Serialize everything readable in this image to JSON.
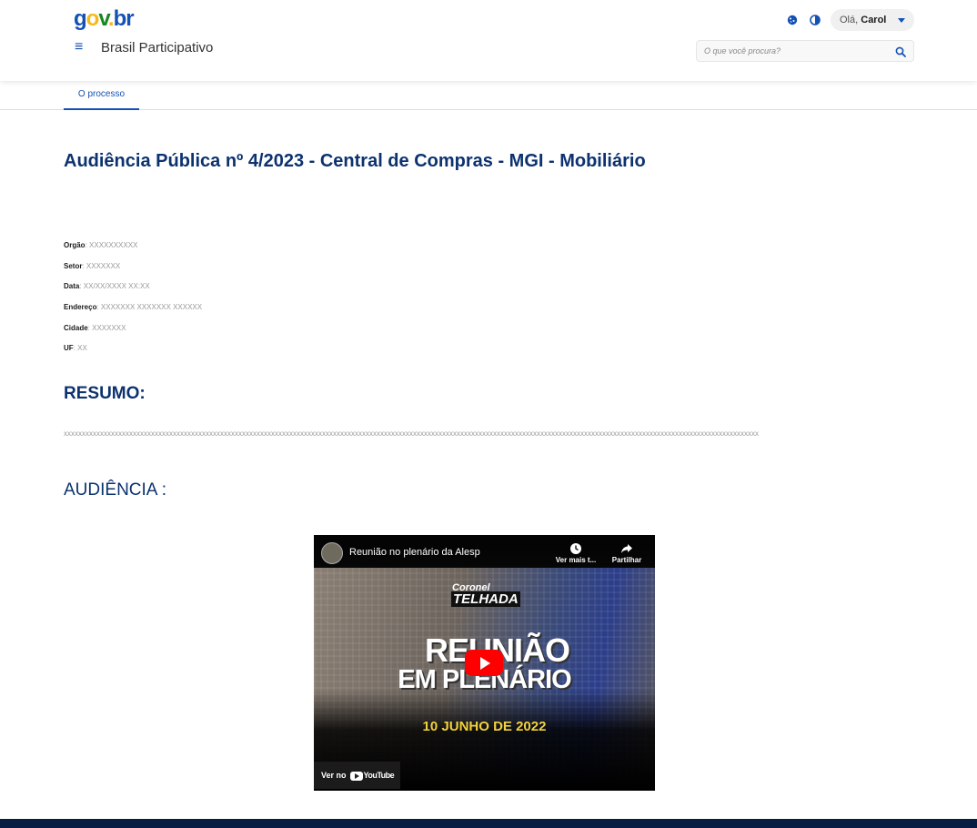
{
  "header": {
    "logo": {
      "g": "g",
      "o": "o",
      "v": "v",
      "dot": ".",
      "b": "b",
      "r": "r"
    },
    "site_title": "Brasil Participativo",
    "greeting": "Olá,",
    "user_name": "Carol",
    "search_placeholder": "O que você procura?"
  },
  "tabs": [
    {
      "label": "O processo"
    }
  ],
  "page": {
    "title": "Audiência Pública nº 4/2023 - Central de Compras - MGI - Mobiliário",
    "info": [
      {
        "label": "Orgão",
        "value": "XXXXXXXXXX"
      },
      {
        "label": "Setor",
        "value": "XXXXXXX"
      },
      {
        "label": "Data",
        "value": "XX/XX/XXXX XX:XX"
      },
      {
        "label": "Endereço",
        "value": "XXXXXXX XXXXXXX XXXXXX"
      },
      {
        "label": "Cidade",
        "value": "XXXXXXX"
      },
      {
        "label": "UF",
        "value": "XX"
      }
    ],
    "resumo_heading": "RESUMO:",
    "resumo_text": "xxxxxxxxxxxxxxxxxxxxxxxxxxxxxxxxxxxxxxxxxxxxxxxxxxxxxxxxxxxxxxxxxxxxxxxxxxxxxxxxxxxxxxxxxxxxxxxxxxxxxxxxxxxxxxxxxxxxxxxxxxxxxxxxxxxxxxxxxxxxxxxxxxxxxxxxxxxxxxxxxxxxxxxxxxxxxxxxxxxxxxxxxxxxxxx",
    "audiencia_heading": "AUDIÊNCIA :"
  },
  "video": {
    "title": "Reunião no plenário da Alesp",
    "watch_later": "Ver mais t...",
    "share": "Partilhar",
    "brand_line1": "Coronel",
    "brand_line2": "TELHADA",
    "headline1": "REUNIÃO",
    "headline2": "EM PLENÁRIO",
    "date": "10 JUNHO DE 2022",
    "watch_on": "Ver no",
    "youtube": "YouTube"
  },
  "colors": {
    "primary": "#1351b4",
    "heading": "#0c326f",
    "footer": "#071d41"
  }
}
